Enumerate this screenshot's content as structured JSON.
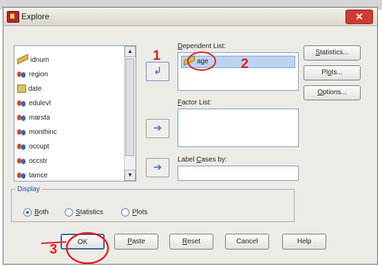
{
  "background": {
    "left_text": "",
    "mid_text_1": "",
    "mid_text_2": "",
    "right_text": ""
  },
  "window": {
    "title": "Explore",
    "close_glyph": "✕"
  },
  "variables": [
    {
      "name": "idnum",
      "icon": "ruler-icon"
    },
    {
      "name": "region",
      "icon": "people-icon"
    },
    {
      "name": "date",
      "icon": "calendar-icon"
    },
    {
      "name": "edulevl",
      "icon": "people-icon"
    },
    {
      "name": "marsta",
      "icon": "people-icon"
    },
    {
      "name": "monthinc",
      "icon": "people-icon"
    },
    {
      "name": "occupt",
      "icon": "people-icon"
    },
    {
      "name": "occstr",
      "icon": "people-icon"
    },
    {
      "name": "tamce",
      "icon": "people-icon"
    }
  ],
  "dependent_list": {
    "label_pre": "",
    "label_u": "D",
    "label_post": "ependent List:",
    "items": [
      "age"
    ]
  },
  "factor_list": {
    "label_u": "F",
    "label_post": "actor List:"
  },
  "label_cases": {
    "label_pre": "Label ",
    "label_u": "C",
    "label_post": "ases by:"
  },
  "side_buttons": {
    "statistics": {
      "u": "S",
      "rest": "tatistics..."
    },
    "plots": {
      "pre": "Pl",
      "u": "o",
      "rest": "ts..."
    },
    "options": {
      "u": "O",
      "rest": "ptions..."
    }
  },
  "display": {
    "title": "Display",
    "options": [
      {
        "pre": "",
        "u": "B",
        "rest": "oth",
        "checked": true
      },
      {
        "pre": "",
        "u": "S",
        "rest": "tatistics",
        "checked": false
      },
      {
        "pre": "",
        "u": "P",
        "rest": "lots",
        "checked": false
      }
    ]
  },
  "bottom_buttons": {
    "ok": "OK",
    "paste": {
      "u": "P",
      "rest": "aste"
    },
    "reset": {
      "u": "R",
      "rest": "eset"
    },
    "cancel": "Cancel",
    "help": "Help"
  },
  "annotations": {
    "n1": "1",
    "n2": "2",
    "n3": "3",
    "color": "#e0201e"
  },
  "colors": {
    "dialog_bg": "#ecebe6",
    "selection": "#bcd3f0",
    "arrow_blue": "#3b63b8"
  }
}
